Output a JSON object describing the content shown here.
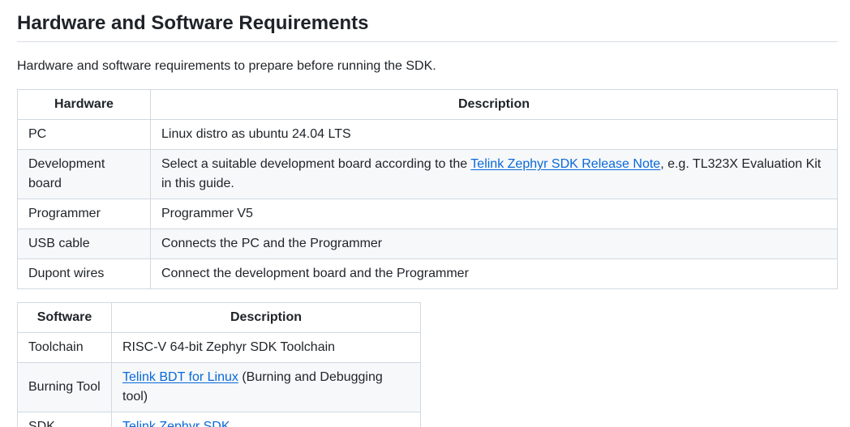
{
  "heading": "Hardware and Software Requirements",
  "intro": "Hardware and software requirements to prepare before running the SDK.",
  "hardware_table": {
    "headers": [
      "Hardware",
      "Description"
    ],
    "rows": [
      {
        "item": "PC",
        "desc": "Linux distro as ubuntu 24.04 LTS"
      },
      {
        "item": "Development board",
        "desc_before": "Select a suitable development board according to the ",
        "link": "Telink Zephyr SDK Release Note",
        "desc_after": ", e.g. TL323X Evaluation Kit in this guide."
      },
      {
        "item": "Programmer",
        "desc": "Programmer V5"
      },
      {
        "item": "USB cable",
        "desc": "Connects the PC and the Programmer"
      },
      {
        "item": "Dupont wires",
        "desc": "Connect the development board and the Programmer"
      }
    ]
  },
  "software_table": {
    "headers": [
      "Software",
      "Description"
    ],
    "rows": [
      {
        "item": "Toolchain",
        "desc": "RISC-V 64-bit Zephyr SDK Toolchain"
      },
      {
        "item": "Burning Tool",
        "link": "Telink BDT for Linux",
        "desc_after": " (Burning and Debugging tool)"
      },
      {
        "item": "SDK",
        "link": "Telink Zephyr SDK"
      }
    ]
  },
  "colors": {
    "text": "#1f2328",
    "link": "#0969da",
    "border": "#d1d9e0",
    "alt_row": "#f6f8fa"
  }
}
